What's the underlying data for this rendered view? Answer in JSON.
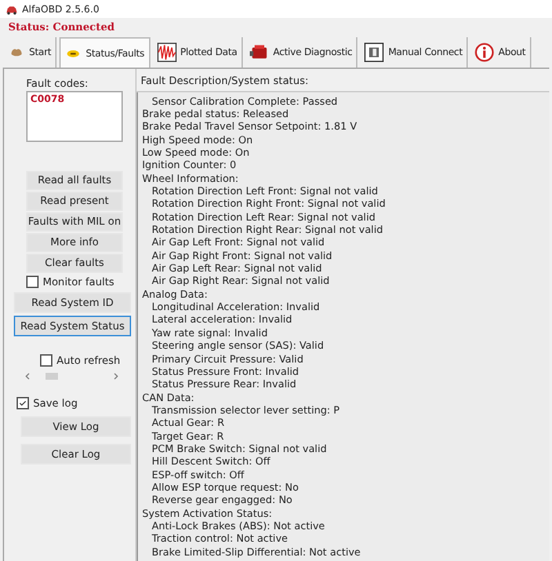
{
  "window": {
    "title": "AlfaOBD 2.5.6.0"
  },
  "status": "Status: Connected",
  "tabs": [
    {
      "label": "Start",
      "selected": false
    },
    {
      "label": "Status/Faults",
      "selected": true
    },
    {
      "label": "Plotted Data",
      "selected": false
    },
    {
      "label": "Active Diagnostic",
      "selected": false
    },
    {
      "label": "Manual Connect",
      "selected": false
    },
    {
      "label": "About",
      "selected": false
    }
  ],
  "fault_codes": {
    "label": "Fault codes:",
    "codes": [
      "C0078"
    ]
  },
  "fault_buttons": [
    "Read all faults",
    "Read present",
    "Faults with MIL on",
    "More info",
    "Clear faults"
  ],
  "monitor_faults": {
    "label": "Monitor faults",
    "checked": false
  },
  "system_buttons": [
    {
      "label": "Read System ID",
      "selected": false
    },
    {
      "label": "Read System Status",
      "selected": true
    }
  ],
  "auto_refresh": {
    "label": "Auto refresh",
    "checked": false
  },
  "save_log": {
    "label": "Save log",
    "checked": true
  },
  "log_buttons": [
    "View Log",
    "Clear Log"
  ],
  "description": {
    "label": "Fault Description/System status:",
    "lines": [
      {
        "children": [
          {
            "text": "Sensor Calibration Complete: Passed"
          }
        ]
      },
      {
        "text": "Brake pedal status: Released"
      },
      {
        "text": "Brake Pedal Travel Sensor Setpoint: 1.81 V"
      },
      {
        "text": "High Speed mode: On"
      },
      {
        "text": "Low Speed mode: On"
      },
      {
        "text": "Ignition Counter: 0"
      },
      {
        "text": "Wheel Information:",
        "children": [
          {
            "text": "Rotation Direction Left Front: Signal not valid"
          },
          {
            "text": "Rotation Direction Right Front: Signal not valid"
          },
          {
            "text": "Rotation Direction Left Rear: Signal not valid"
          },
          {
            "text": "Rotation Direction Right Rear: Signal not valid"
          },
          {
            "text": "Air Gap Left Front: Signal not valid"
          },
          {
            "text": "Air Gap Right Front: Signal not valid"
          },
          {
            "text": "Air Gap Left Rear: Signal not valid"
          },
          {
            "text": "Air Gap Right Rear: Signal not valid"
          }
        ]
      },
      {
        "text": "Analog Data:",
        "children": [
          {
            "text": "Longitudinal Acceleration: Invalid"
          },
          {
            "text": "Lateral acceleration: Invalid"
          },
          {
            "text": "Yaw rate signal: Invalid"
          },
          {
            "text": "Steering angle sensor (SAS): Valid"
          },
          {
            "text": "Primary Circuit Pressure: Valid"
          },
          {
            "text": "Status Pressure Front: Invalid"
          },
          {
            "text": "Status Pressure Rear: Invalid"
          }
        ]
      },
      {
        "text": "CAN Data:",
        "children": [
          {
            "text": "Transmission selector lever setting: P"
          },
          {
            "text": "Actual Gear: R"
          },
          {
            "text": "Target Gear: R"
          },
          {
            "text": "PCM Brake Switch: Signal not valid"
          },
          {
            "text": "Hill Descent Switch: Off"
          },
          {
            "text": "ESP-off switch: Off"
          },
          {
            "text": "Allow ESP torque request: No"
          },
          {
            "text": "Reverse gear engagged: No"
          }
        ]
      },
      {
        "text": "System Activation Status:",
        "children": [
          {
            "text": "Anti-Lock Brakes (ABS): Not active"
          },
          {
            "text": "Traction control: Not active"
          },
          {
            "text": "Brake Limited-Slip Differential: Not active"
          }
        ]
      }
    ]
  }
}
